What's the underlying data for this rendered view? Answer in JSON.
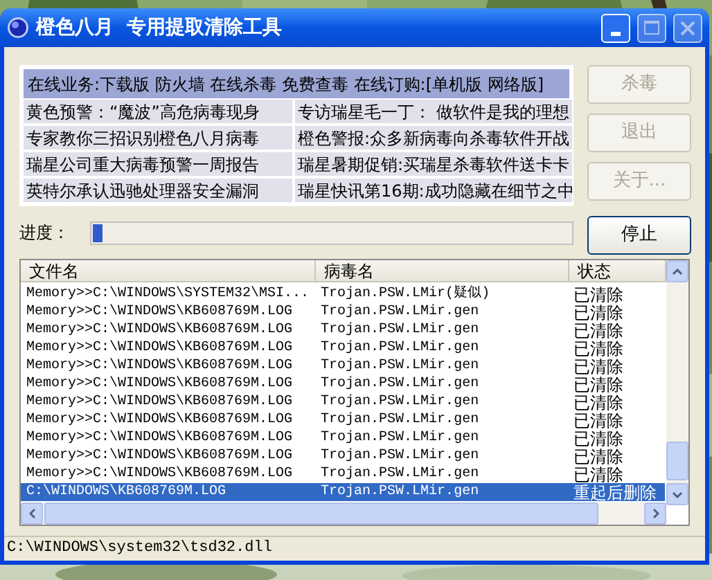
{
  "window": {
    "title": "橙色八月  专用提取清除工具"
  },
  "news": {
    "header": "在线业务:下载版 防火墙 在线杀毒 免费查毒 在线订购:[单机版 网络版]",
    "items": [
      "黄色预警：“魔波”高危病毒现身",
      "专访瑞星毛一丁： 做软件是我的理想",
      "专家教你三招识别橙色八月病毒",
      "橙色警报:众多新病毒向杀毒软件开战",
      "瑞星公司重大病毒预警一周报告",
      "瑞星暑期促销:买瑞星杀毒软件送卡卡",
      "英特尔承认迅驰处理器安全漏洞",
      "瑞星快讯第16期:成功隐藏在细节之中"
    ]
  },
  "side_buttons": [
    {
      "label": "杀毒",
      "disabled": true
    },
    {
      "label": "退出",
      "disabled": true
    },
    {
      "label": "关于...",
      "disabled": true
    }
  ],
  "progress": {
    "label": "进度：",
    "level": 0.02
  },
  "stop_button": {
    "label": "停止",
    "disabled": false
  },
  "table": {
    "columns": [
      "文件名",
      "病毒名",
      "状态"
    ],
    "rows": [
      {
        "file": "Memory>>C:\\WINDOWS\\SYSTEM32\\MSI...",
        "virus": "Trojan.PSW.LMir(疑似)",
        "status": "已清除",
        "selected": false
      },
      {
        "file": "Memory>>C:\\WINDOWS\\KB608769M.LOG",
        "virus": "Trojan.PSW.LMir.gen",
        "status": "已清除",
        "selected": false
      },
      {
        "file": "Memory>>C:\\WINDOWS\\KB608769M.LOG",
        "virus": "Trojan.PSW.LMir.gen",
        "status": "已清除",
        "selected": false
      },
      {
        "file": "Memory>>C:\\WINDOWS\\KB608769M.LOG",
        "virus": "Trojan.PSW.LMir.gen",
        "status": "已清除",
        "selected": false
      },
      {
        "file": "Memory>>C:\\WINDOWS\\KB608769M.LOG",
        "virus": "Trojan.PSW.LMir.gen",
        "status": "已清除",
        "selected": false
      },
      {
        "file": "Memory>>C:\\WINDOWS\\KB608769M.LOG",
        "virus": "Trojan.PSW.LMir.gen",
        "status": "已清除",
        "selected": false
      },
      {
        "file": "Memory>>C:\\WINDOWS\\KB608769M.LOG",
        "virus": "Trojan.PSW.LMir.gen",
        "status": "已清除",
        "selected": false
      },
      {
        "file": "Memory>>C:\\WINDOWS\\KB608769M.LOG",
        "virus": "Trojan.PSW.LMir.gen",
        "status": "已清除",
        "selected": false
      },
      {
        "file": "Memory>>C:\\WINDOWS\\KB608769M.LOG",
        "virus": "Trojan.PSW.LMir.gen",
        "status": "已清除",
        "selected": false
      },
      {
        "file": "Memory>>C:\\WINDOWS\\KB608769M.LOG",
        "virus": "Trojan.PSW.LMir.gen",
        "status": "已清除",
        "selected": false
      },
      {
        "file": "Memory>>C:\\WINDOWS\\KB608769M.LOG",
        "virus": "Trojan.PSW.LMir.gen",
        "status": "已清除",
        "selected": false
      },
      {
        "file": "C:\\WINDOWS\\KB608769M.LOG",
        "virus": "Trojan.PSW.LMir.gen",
        "status": "重起后删除",
        "selected": true
      }
    ]
  },
  "status_bar": "C:\\WINDOWS\\system32\\tsd32.dll"
}
